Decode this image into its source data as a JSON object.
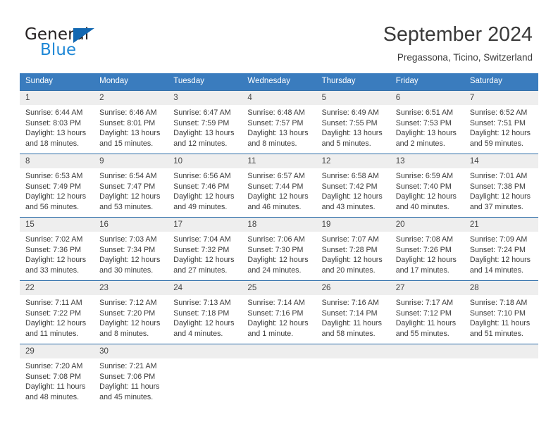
{
  "brand": {
    "name_top": "General",
    "name_bottom": "Blue",
    "accent_color": "#1267b1",
    "accent_color_light": "#1e87d6"
  },
  "header": {
    "title": "September 2024",
    "location": "Pregassona, Ticino, Switzerland"
  },
  "theme": {
    "header_row_bg": "#3a7cbe",
    "daynum_bg": "#eeeeee",
    "row_divider": "#2b6ca8",
    "text": "#3b3b3b"
  },
  "weekday_headers": [
    "Sunday",
    "Monday",
    "Tuesday",
    "Wednesday",
    "Thursday",
    "Friday",
    "Saturday"
  ],
  "weeks": [
    [
      {
        "day": "1",
        "sunrise": "Sunrise: 6:44 AM",
        "sunset": "Sunset: 8:03 PM",
        "daylight1": "Daylight: 13 hours",
        "daylight2": "and 18 minutes."
      },
      {
        "day": "2",
        "sunrise": "Sunrise: 6:46 AM",
        "sunset": "Sunset: 8:01 PM",
        "daylight1": "Daylight: 13 hours",
        "daylight2": "and 15 minutes."
      },
      {
        "day": "3",
        "sunrise": "Sunrise: 6:47 AM",
        "sunset": "Sunset: 7:59 PM",
        "daylight1": "Daylight: 13 hours",
        "daylight2": "and 12 minutes."
      },
      {
        "day": "4",
        "sunrise": "Sunrise: 6:48 AM",
        "sunset": "Sunset: 7:57 PM",
        "daylight1": "Daylight: 13 hours",
        "daylight2": "and 8 minutes."
      },
      {
        "day": "5",
        "sunrise": "Sunrise: 6:49 AM",
        "sunset": "Sunset: 7:55 PM",
        "daylight1": "Daylight: 13 hours",
        "daylight2": "and 5 minutes."
      },
      {
        "day": "6",
        "sunrise": "Sunrise: 6:51 AM",
        "sunset": "Sunset: 7:53 PM",
        "daylight1": "Daylight: 13 hours",
        "daylight2": "and 2 minutes."
      },
      {
        "day": "7",
        "sunrise": "Sunrise: 6:52 AM",
        "sunset": "Sunset: 7:51 PM",
        "daylight1": "Daylight: 12 hours",
        "daylight2": "and 59 minutes."
      }
    ],
    [
      {
        "day": "8",
        "sunrise": "Sunrise: 6:53 AM",
        "sunset": "Sunset: 7:49 PM",
        "daylight1": "Daylight: 12 hours",
        "daylight2": "and 56 minutes."
      },
      {
        "day": "9",
        "sunrise": "Sunrise: 6:54 AM",
        "sunset": "Sunset: 7:47 PM",
        "daylight1": "Daylight: 12 hours",
        "daylight2": "and 53 minutes."
      },
      {
        "day": "10",
        "sunrise": "Sunrise: 6:56 AM",
        "sunset": "Sunset: 7:46 PM",
        "daylight1": "Daylight: 12 hours",
        "daylight2": "and 49 minutes."
      },
      {
        "day": "11",
        "sunrise": "Sunrise: 6:57 AM",
        "sunset": "Sunset: 7:44 PM",
        "daylight1": "Daylight: 12 hours",
        "daylight2": "and 46 minutes."
      },
      {
        "day": "12",
        "sunrise": "Sunrise: 6:58 AM",
        "sunset": "Sunset: 7:42 PM",
        "daylight1": "Daylight: 12 hours",
        "daylight2": "and 43 minutes."
      },
      {
        "day": "13",
        "sunrise": "Sunrise: 6:59 AM",
        "sunset": "Sunset: 7:40 PM",
        "daylight1": "Daylight: 12 hours",
        "daylight2": "and 40 minutes."
      },
      {
        "day": "14",
        "sunrise": "Sunrise: 7:01 AM",
        "sunset": "Sunset: 7:38 PM",
        "daylight1": "Daylight: 12 hours",
        "daylight2": "and 37 minutes."
      }
    ],
    [
      {
        "day": "15",
        "sunrise": "Sunrise: 7:02 AM",
        "sunset": "Sunset: 7:36 PM",
        "daylight1": "Daylight: 12 hours",
        "daylight2": "and 33 minutes."
      },
      {
        "day": "16",
        "sunrise": "Sunrise: 7:03 AM",
        "sunset": "Sunset: 7:34 PM",
        "daylight1": "Daylight: 12 hours",
        "daylight2": "and 30 minutes."
      },
      {
        "day": "17",
        "sunrise": "Sunrise: 7:04 AM",
        "sunset": "Sunset: 7:32 PM",
        "daylight1": "Daylight: 12 hours",
        "daylight2": "and 27 minutes."
      },
      {
        "day": "18",
        "sunrise": "Sunrise: 7:06 AM",
        "sunset": "Sunset: 7:30 PM",
        "daylight1": "Daylight: 12 hours",
        "daylight2": "and 24 minutes."
      },
      {
        "day": "19",
        "sunrise": "Sunrise: 7:07 AM",
        "sunset": "Sunset: 7:28 PM",
        "daylight1": "Daylight: 12 hours",
        "daylight2": "and 20 minutes."
      },
      {
        "day": "20",
        "sunrise": "Sunrise: 7:08 AM",
        "sunset": "Sunset: 7:26 PM",
        "daylight1": "Daylight: 12 hours",
        "daylight2": "and 17 minutes."
      },
      {
        "day": "21",
        "sunrise": "Sunrise: 7:09 AM",
        "sunset": "Sunset: 7:24 PM",
        "daylight1": "Daylight: 12 hours",
        "daylight2": "and 14 minutes."
      }
    ],
    [
      {
        "day": "22",
        "sunrise": "Sunrise: 7:11 AM",
        "sunset": "Sunset: 7:22 PM",
        "daylight1": "Daylight: 12 hours",
        "daylight2": "and 11 minutes."
      },
      {
        "day": "23",
        "sunrise": "Sunrise: 7:12 AM",
        "sunset": "Sunset: 7:20 PM",
        "daylight1": "Daylight: 12 hours",
        "daylight2": "and 8 minutes."
      },
      {
        "day": "24",
        "sunrise": "Sunrise: 7:13 AM",
        "sunset": "Sunset: 7:18 PM",
        "daylight1": "Daylight: 12 hours",
        "daylight2": "and 4 minutes."
      },
      {
        "day": "25",
        "sunrise": "Sunrise: 7:14 AM",
        "sunset": "Sunset: 7:16 PM",
        "daylight1": "Daylight: 12 hours",
        "daylight2": "and 1 minute."
      },
      {
        "day": "26",
        "sunrise": "Sunrise: 7:16 AM",
        "sunset": "Sunset: 7:14 PM",
        "daylight1": "Daylight: 11 hours",
        "daylight2": "and 58 minutes."
      },
      {
        "day": "27",
        "sunrise": "Sunrise: 7:17 AM",
        "sunset": "Sunset: 7:12 PM",
        "daylight1": "Daylight: 11 hours",
        "daylight2": "and 55 minutes."
      },
      {
        "day": "28",
        "sunrise": "Sunrise: 7:18 AM",
        "sunset": "Sunset: 7:10 PM",
        "daylight1": "Daylight: 11 hours",
        "daylight2": "and 51 minutes."
      }
    ],
    [
      {
        "day": "29",
        "sunrise": "Sunrise: 7:20 AM",
        "sunset": "Sunset: 7:08 PM",
        "daylight1": "Daylight: 11 hours",
        "daylight2": "and 48 minutes."
      },
      {
        "day": "30",
        "sunrise": "Sunrise: 7:21 AM",
        "sunset": "Sunset: 7:06 PM",
        "daylight1": "Daylight: 11 hours",
        "daylight2": "and 45 minutes."
      },
      {
        "day": "",
        "sunrise": "",
        "sunset": "",
        "daylight1": "",
        "daylight2": ""
      },
      {
        "day": "",
        "sunrise": "",
        "sunset": "",
        "daylight1": "",
        "daylight2": ""
      },
      {
        "day": "",
        "sunrise": "",
        "sunset": "",
        "daylight1": "",
        "daylight2": ""
      },
      {
        "day": "",
        "sunrise": "",
        "sunset": "",
        "daylight1": "",
        "daylight2": ""
      },
      {
        "day": "",
        "sunrise": "",
        "sunset": "",
        "daylight1": "",
        "daylight2": ""
      }
    ]
  ]
}
